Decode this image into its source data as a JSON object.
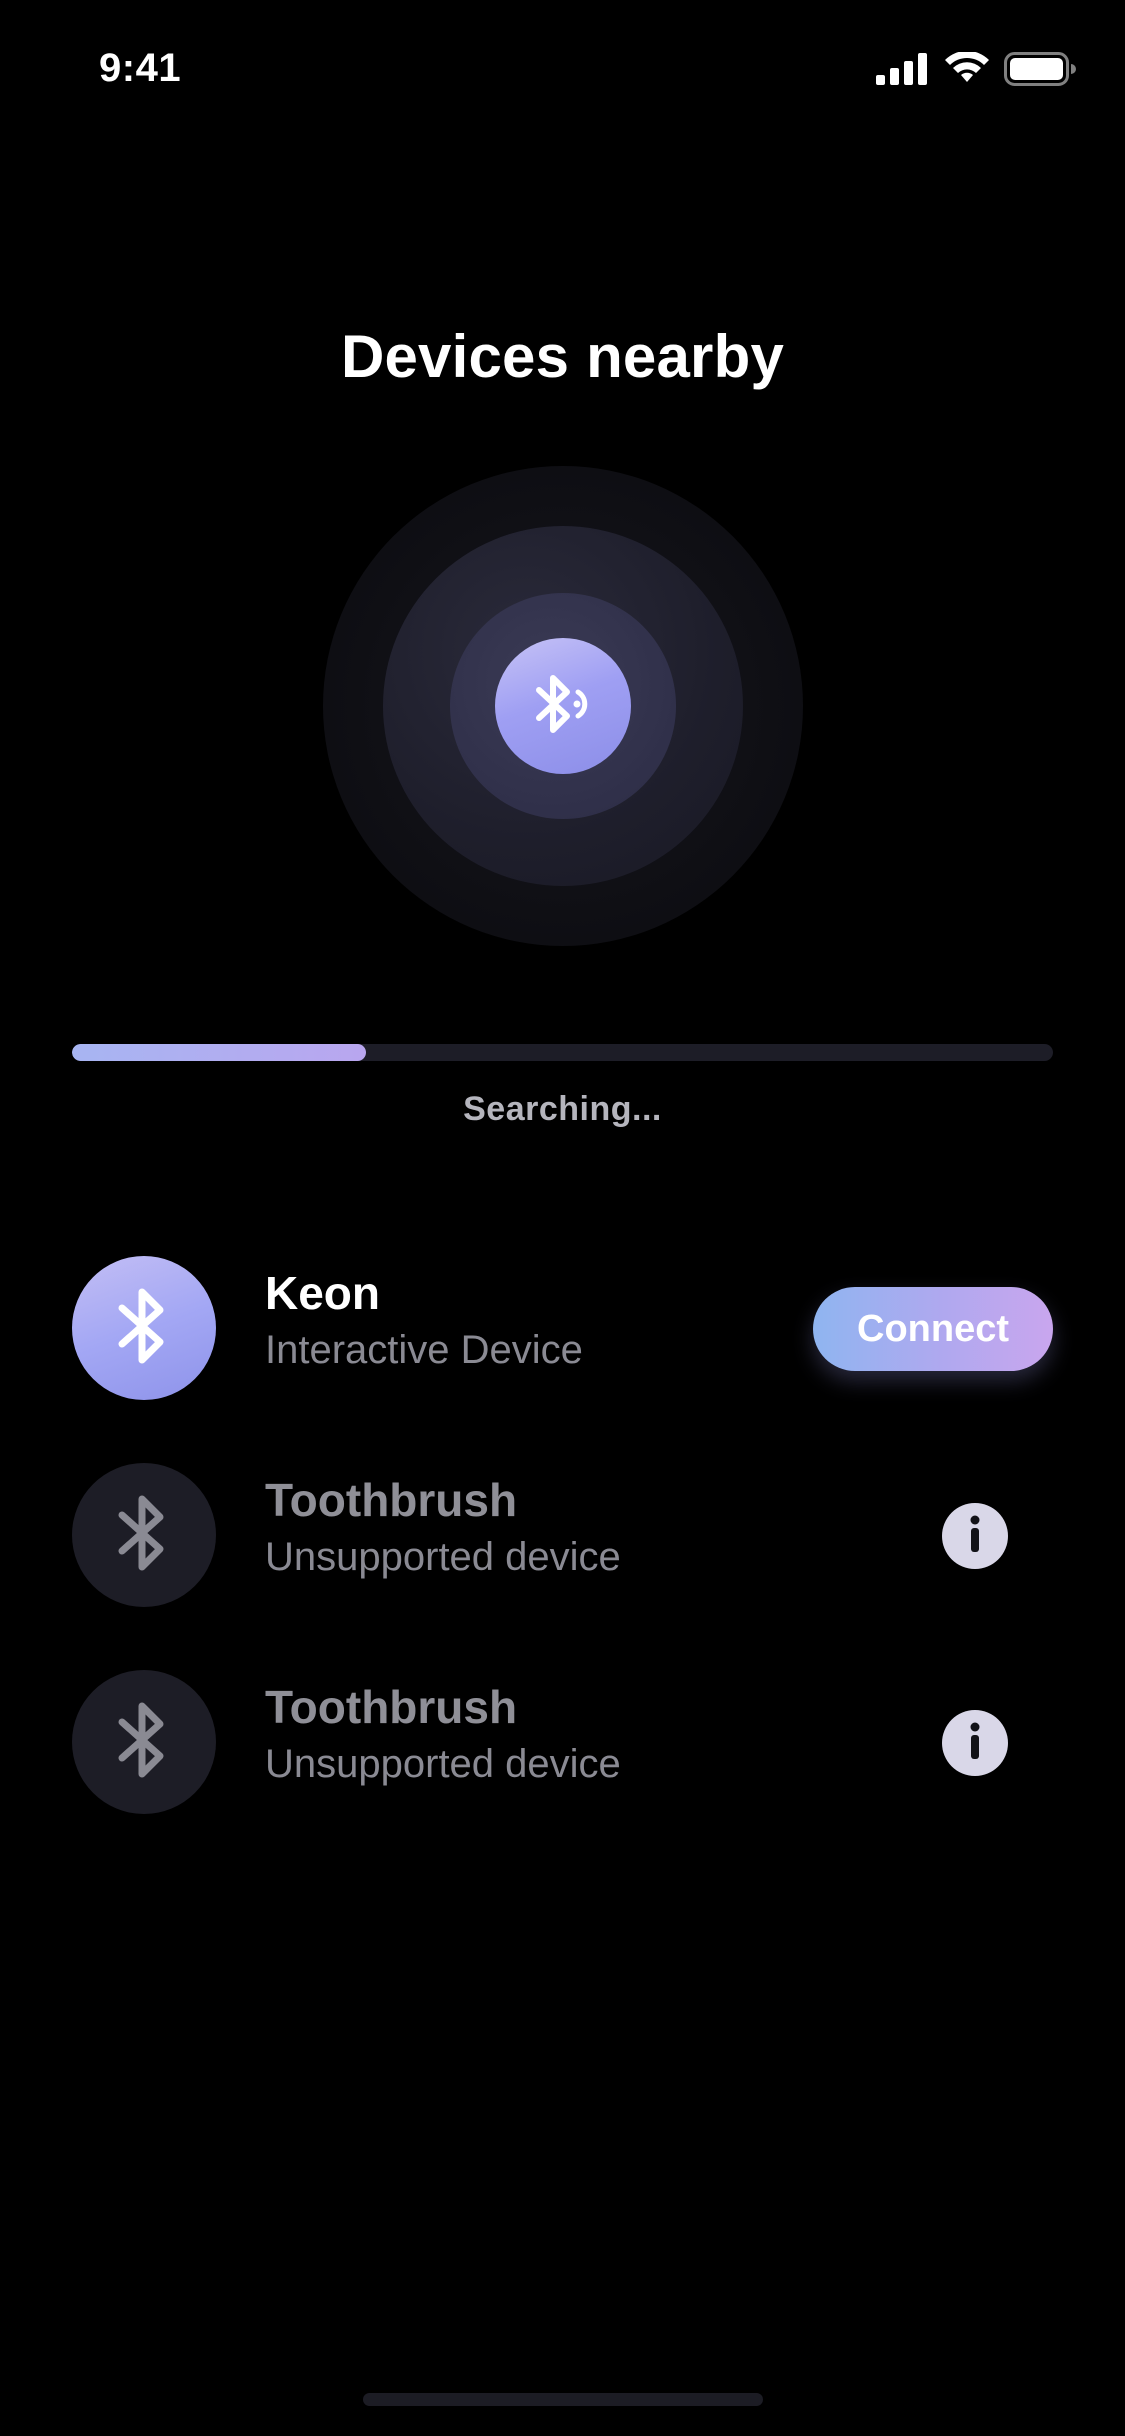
{
  "status_bar": {
    "time": "9:41",
    "icons": [
      "cellular-signal-icon",
      "wifi-icon",
      "battery-icon"
    ]
  },
  "header": {
    "title": "Devices nearby"
  },
  "radar": {
    "icon": "bluetooth-searching-icon",
    "accent_color": "#9f9ff3"
  },
  "search_progress": {
    "value_percent": 30,
    "label": "Searching..."
  },
  "devices": [
    {
      "name": "Keon",
      "type": "Interactive Device",
      "icon": "bluetooth-icon",
      "state": "available",
      "action_label": "Connect"
    },
    {
      "name": "Toothbrush",
      "type": "Unsupported device",
      "icon": "bluetooth-icon",
      "state": "unsupported",
      "action_icon": "info-icon"
    },
    {
      "name": "Toothbrush",
      "type": "Unsupported device",
      "icon": "bluetooth-icon",
      "state": "unsupported",
      "action_icon": "info-icon"
    }
  ],
  "colors": {
    "background": "#000000",
    "accent_gradient_start": "#8fb5f0",
    "accent_gradient_end": "#c9a6ee",
    "inactive_avatar": "#1d1d26",
    "secondary_text": "#8a8a93"
  }
}
